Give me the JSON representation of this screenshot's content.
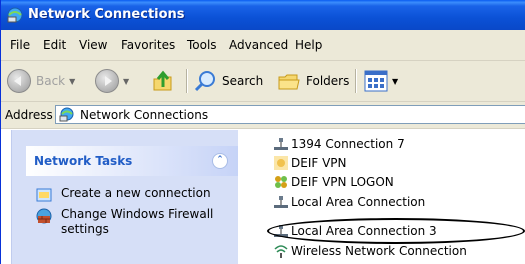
{
  "window": {
    "title": "Network Connections"
  },
  "menu": [
    "File",
    "Edit",
    "View",
    "Favorites",
    "Tools",
    "Advanced",
    "Help"
  ],
  "toolbar": {
    "back_label": "Back",
    "search_label": "Search",
    "folders_label": "Folders"
  },
  "address": {
    "label": "Address",
    "value": "Network Connections"
  },
  "tasks": {
    "title": "Network Tasks",
    "collapse_glyph": "»",
    "items": [
      {
        "label": "Create a new connection",
        "icon": "new-connection-icon"
      },
      {
        "label": "Change Windows Firewall settings",
        "icon": "firewall-icon"
      }
    ]
  },
  "connections": [
    {
      "label": "1394 Connection 7",
      "icon": "lan-icon"
    },
    {
      "label": "DEIF VPN",
      "icon": "vpn-icon"
    },
    {
      "label": "DEIF VPN LOGON",
      "icon": "vpn-logon-icon"
    },
    {
      "label": "Local Area Connection",
      "icon": "lan-icon"
    },
    {
      "label": "Local Area Connection 3",
      "icon": "lan-icon"
    },
    {
      "label": "Wireless Network Connection",
      "icon": "wireless-icon"
    }
  ],
  "colors": {
    "titlebar": "#0b51d6",
    "task_pane": "#d6dff7",
    "task_header_text": "#215dc6"
  }
}
